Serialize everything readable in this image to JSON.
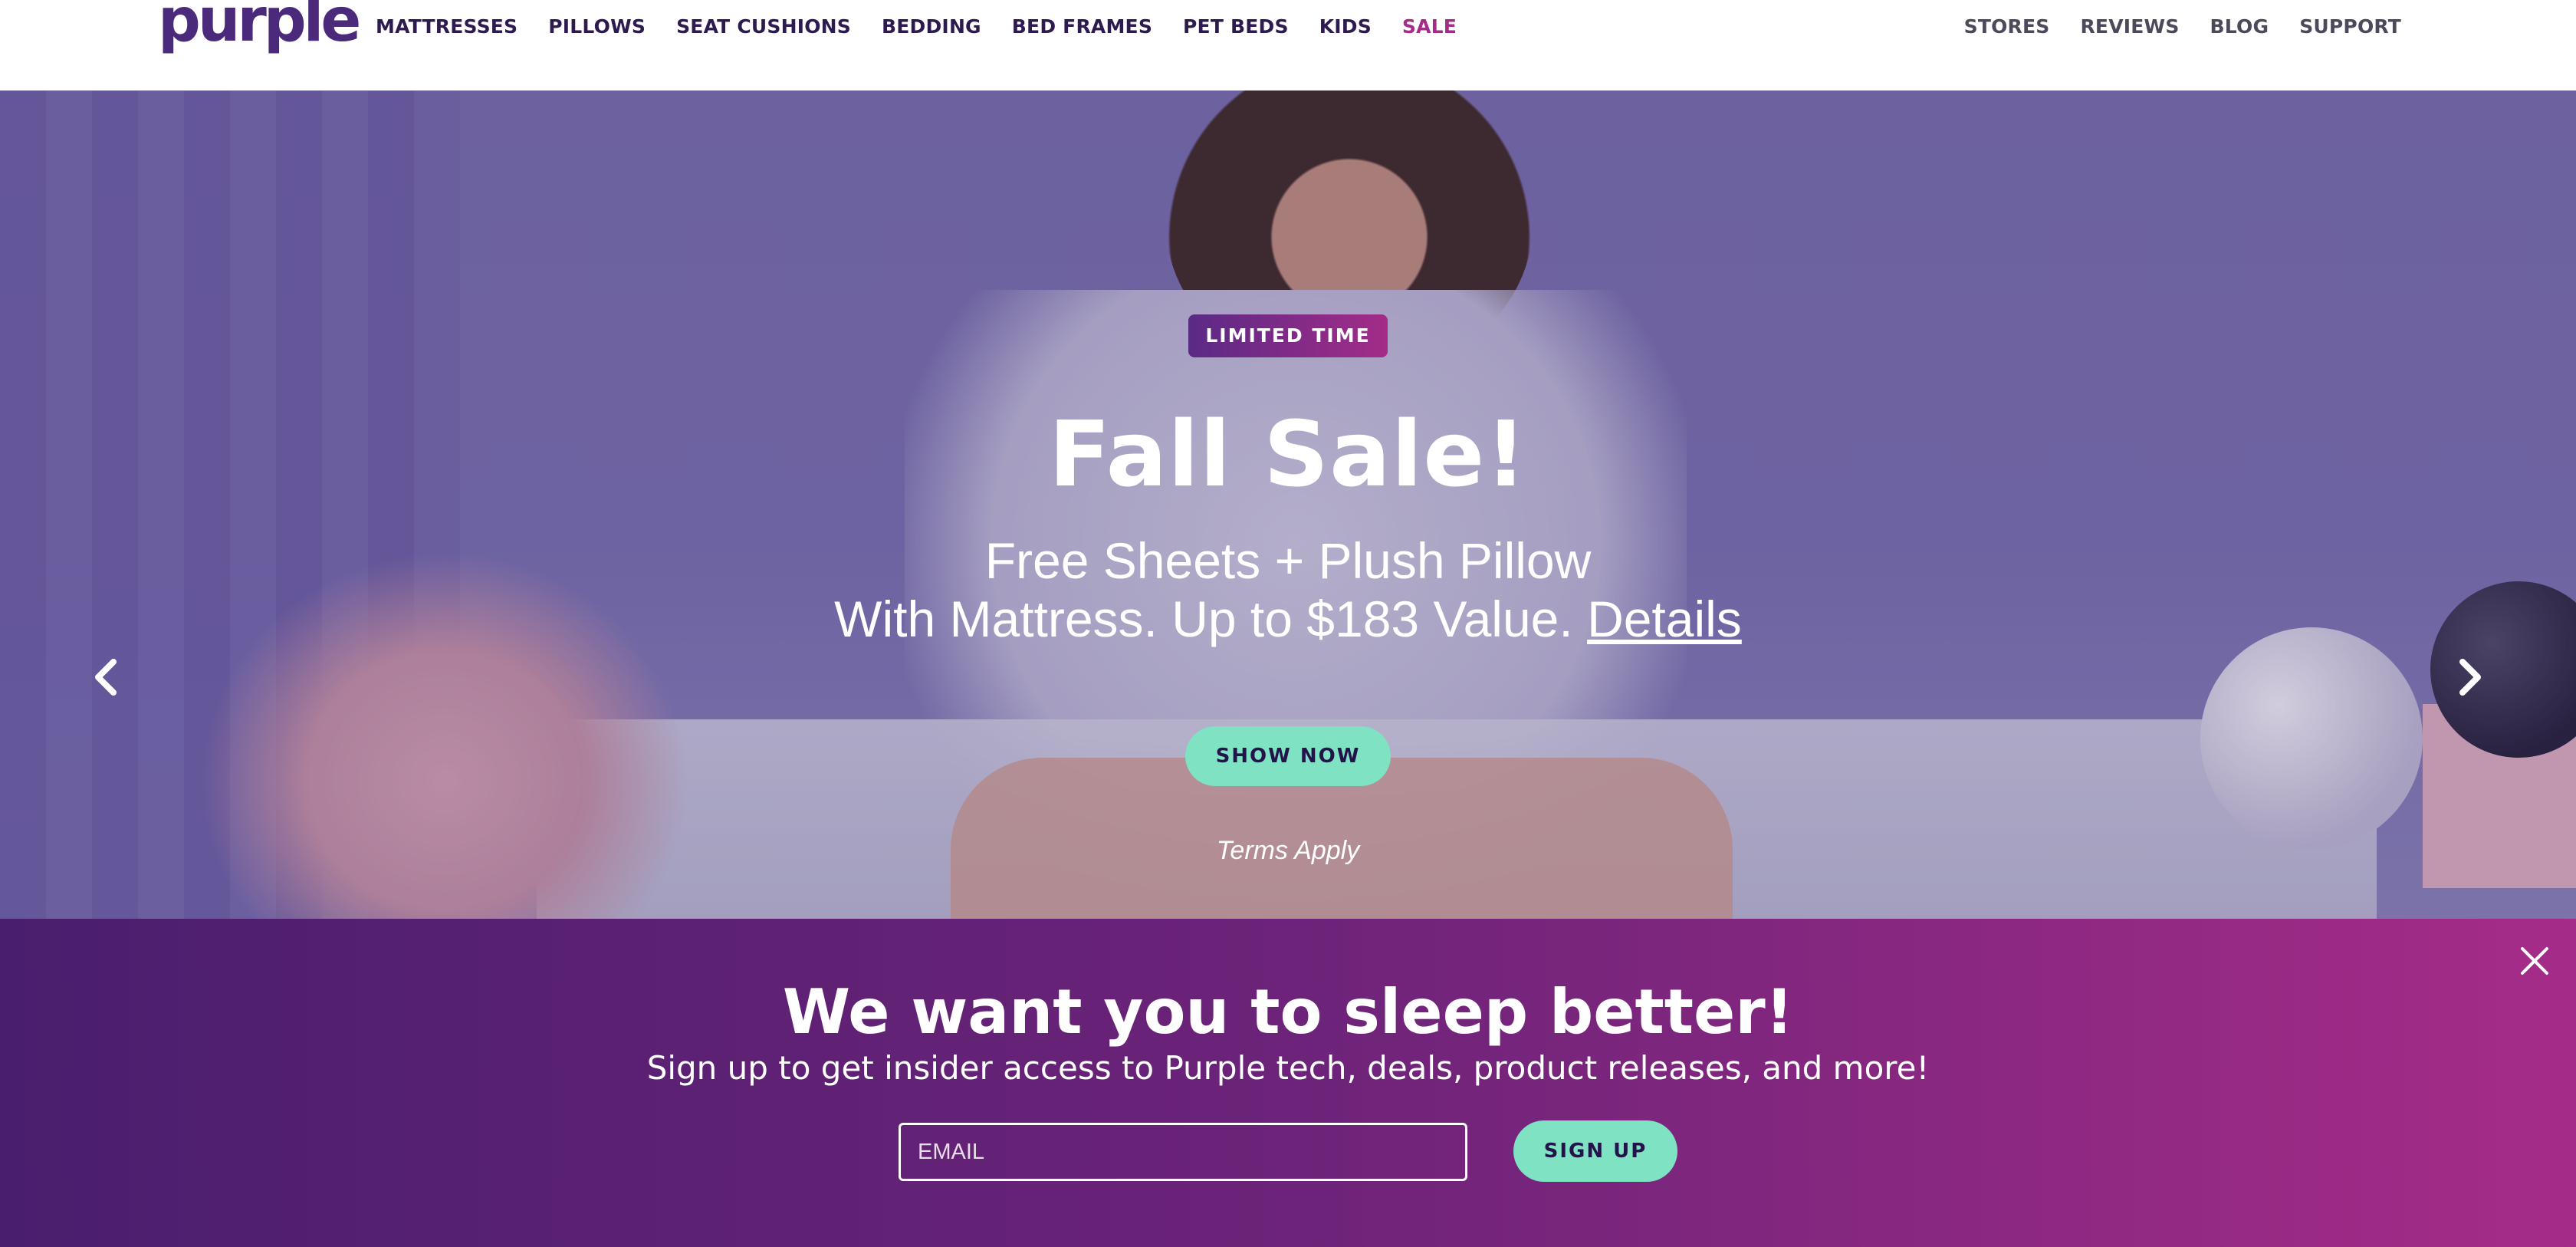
{
  "header": {
    "logo": "purple",
    "nav_left": [
      "MATTRESSES",
      "PILLOWS",
      "SEAT CUSHIONS",
      "BEDDING",
      "BED FRAMES",
      "PET BEDS",
      "KIDS",
      "SALE"
    ],
    "nav_right": [
      "STORES",
      "REVIEWS",
      "BLOG",
      "SUPPORT"
    ]
  },
  "hero": {
    "badge": "LIMITED TIME",
    "title": "Fall Sale!",
    "subtitle_line1": "Free Sheets + Plush Pillow",
    "subtitle_line2": "With Mattress. Up to $183 Value.",
    "details_link": "Details",
    "cta": "SHOW NOW",
    "terms": "Terms Apply",
    "prev_icon": "chevron-left-icon",
    "next_icon": "chevron-right-icon"
  },
  "signup": {
    "title": "We want you to sleep better!",
    "subtitle": "Sign up to get insider access to Purple tech, deals, product releases, and more!",
    "email_placeholder": "EMAIL",
    "button": "SIGN UP",
    "close_icon": "close-icon"
  },
  "colors": {
    "brand_purple": "#4b2a7b",
    "sale_magenta": "#a32c88",
    "cta_mint": "#7ee2c3",
    "banner_start": "#4a1e6e",
    "banner_end": "#a52c88"
  }
}
